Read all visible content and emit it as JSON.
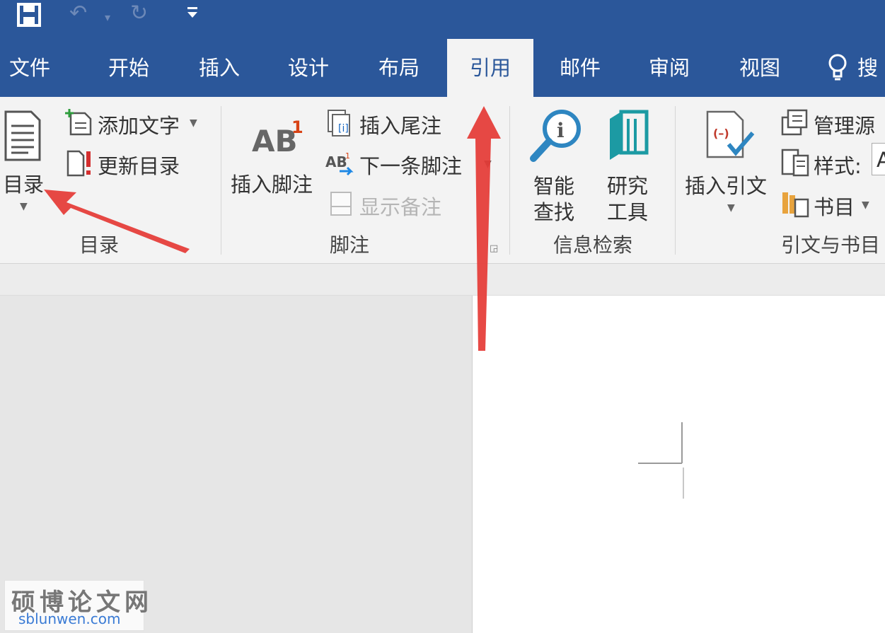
{
  "quick_access": {
    "save_icon": "save-icon",
    "undo_icon": "undo-icon",
    "redo_icon": "redo-icon",
    "customize_icon": "customize-qat-icon"
  },
  "tabs": [
    {
      "label": "文件"
    },
    {
      "label": "开始"
    },
    {
      "label": "插入"
    },
    {
      "label": "设计"
    },
    {
      "label": "布局"
    },
    {
      "label": "引用",
      "active": true
    },
    {
      "label": "邮件"
    },
    {
      "label": "审阅"
    },
    {
      "label": "视图"
    },
    {
      "label": "搜"
    }
  ],
  "ribbon": {
    "toc_group": {
      "label": "目录",
      "toc_button": "目录",
      "add_text": "添加文字",
      "update_toc": "更新目录"
    },
    "footnote_group": {
      "label": "脚注",
      "insert_footnote": "插入脚注",
      "insert_endnote": "插入尾注",
      "next_footnote": "下一条脚注",
      "show_notes": "显示备注"
    },
    "research_group": {
      "label": "信息检索",
      "smart_lookup_1": "智能",
      "smart_lookup_2": "查找",
      "researcher_1": "研究",
      "researcher_2": "工具"
    },
    "citation_group": {
      "label": "引文与书目",
      "insert_citation": "插入引文",
      "manage_sources": "管理源",
      "style": "样式:",
      "style_value": "A",
      "bibliography": "书目"
    }
  },
  "watermark": {
    "name": "硕博论文网",
    "url": "sblunwen.com"
  },
  "colors": {
    "title_bar": "#2b579a",
    "ribbon": "#f3f3f3",
    "annotation_arrow": "#e53935"
  }
}
